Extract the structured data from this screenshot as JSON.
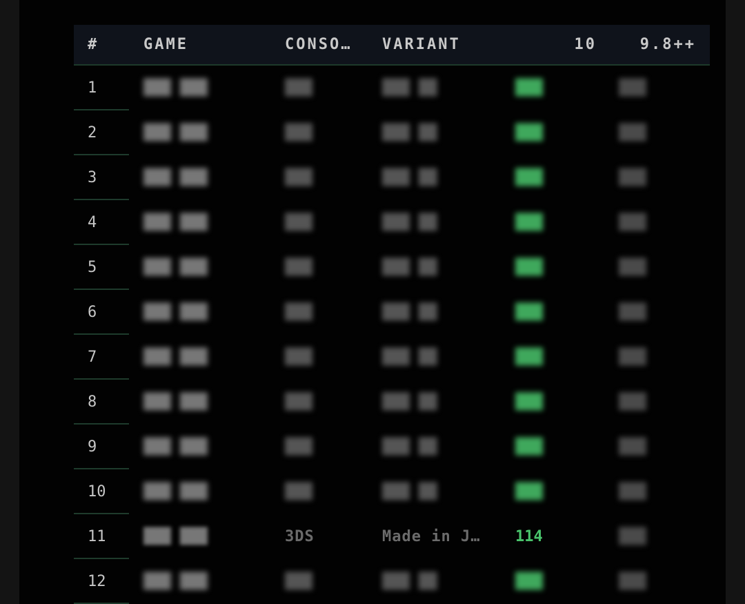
{
  "table": {
    "headers": [
      "#",
      "GAME",
      "CONSO…",
      "VARIANT",
      "10",
      "9.8++"
    ],
    "rows": [
      {
        "rank": "1"
      },
      {
        "rank": "2"
      },
      {
        "rank": "3"
      },
      {
        "rank": "4"
      },
      {
        "rank": "5"
      },
      {
        "rank": "6"
      },
      {
        "rank": "7"
      },
      {
        "rank": "8"
      },
      {
        "rank": "9"
      },
      {
        "rank": "10"
      },
      {
        "rank": "11",
        "console": "3DS",
        "variant": "Made in J…",
        "count_10": "114"
      },
      {
        "rank": "12"
      }
    ]
  },
  "colors": {
    "accent_green": "#49c36b",
    "header_bg": "#0f131b",
    "divider": "#1e3b2c"
  }
}
